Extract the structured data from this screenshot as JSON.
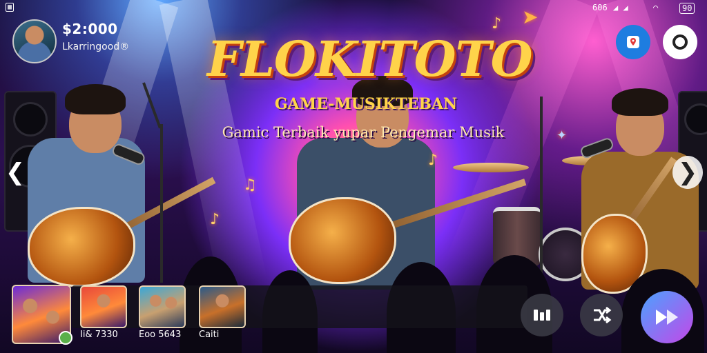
{
  "status_bar": {
    "left_icon": "sim-icon",
    "left_text": "",
    "right_text": "606",
    "battery_text": "90"
  },
  "player": {
    "balance": "$2:000",
    "username": "Lkarringood®"
  },
  "title": {
    "main": "FLOKITOTO",
    "subtitle": "GAME-MUSIKTEBAN",
    "tagline": "Gamic Terbaik yupar Pengemar Musik"
  },
  "top_buttons": {
    "map_icon": "map-pin-icon",
    "settings_icon": "ring-icon"
  },
  "navigation": {
    "prev_glyph": "❮",
    "next_glyph": "❯"
  },
  "games": [
    {
      "label": ""
    },
    {
      "label": "Ii& 7330"
    },
    {
      "label": "Eoo 5643"
    },
    {
      "label": "Caiti"
    }
  ],
  "actions": {
    "pause_icon": "pause-icon",
    "shuffle_icon": "shuffle-icon",
    "play_icon": "play-icon"
  },
  "colors": {
    "accent_blue": "#1e7de0",
    "play_gradient_start": "#4aa3ff",
    "play_gradient_end": "#c447e8",
    "title_gold": "#ffd34a"
  }
}
